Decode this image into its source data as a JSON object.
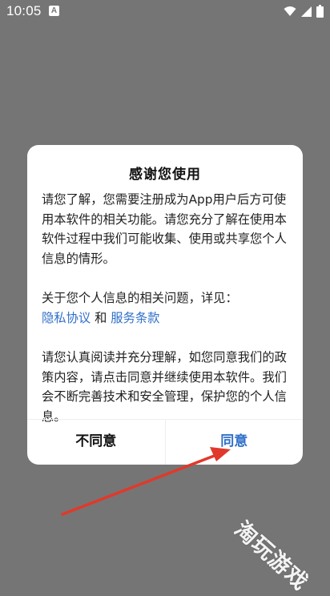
{
  "status_bar": {
    "time": "10:05",
    "app_icon": "A"
  },
  "dialog": {
    "title": "感谢您使用",
    "para1": "请您了解，您需要注册成为App用户后方可使用本软件的相关功能。请您充分了解在使用本软件过程中我们可能收集、使用或共享您个人信息的情形。",
    "para2_prefix": "关于您个人信息的相关问题，详见：",
    "privacy_link": "隐私协议",
    "and_text": " 和 ",
    "terms_link": "服务条款",
    "para3": "请您认真阅读并充分理解，如您同意我们的政策内容，请点击同意并继续使用本软件。我们会不断完善技术和安全管理，保护您的个人信息。",
    "disagree_label": "不同意",
    "agree_label": "同意"
  },
  "watermark": {
    "text": "淘玩游戏"
  },
  "colors": {
    "overlay": "#757575",
    "link": "#2f6fc9",
    "arrow": "#e0392b"
  }
}
